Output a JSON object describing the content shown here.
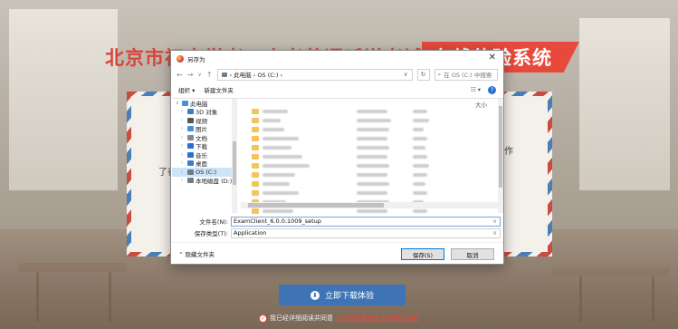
{
  "site": {
    "title_main": "北京市初中学考、高考英语听说考试",
    "title_badge": "在线体验系统",
    "env_left": "了在",
    "env_right": "制作"
  },
  "dialog": {
    "title": "另存为",
    "close": "✕",
    "nav_back": "←",
    "nav_forward": "→",
    "nav_up_arrow": "∨",
    "nav_up": "↑",
    "path": "› 此电脑 › OS (C:) ›",
    "path_dropdown": "∨",
    "refresh": "↻",
    "search_placeholder": "在 OS (C:) 中搜索",
    "organize": "组织 ▾",
    "new_folder": "新建文件夹",
    "view_icons": "☷ ▾",
    "help": "?",
    "tree": [
      {
        "label": "此电脑",
        "arrow": "∨",
        "color": "#4a90d9",
        "selected": false
      },
      {
        "label": "3D 对象",
        "arrow": "›",
        "color": "#3b7fc9",
        "selected": false
      },
      {
        "label": "视频",
        "arrow": "›",
        "color": "#555555",
        "selected": false
      },
      {
        "label": "图片",
        "arrow": "›",
        "color": "#4a90d9",
        "selected": false
      },
      {
        "label": "文档",
        "arrow": "›",
        "color": "#7a8c9c",
        "selected": false
      },
      {
        "label": "下载",
        "arrow": "›",
        "color": "#2a6fd6",
        "selected": false
      },
      {
        "label": "音乐",
        "arrow": "›",
        "color": "#2a6fd6",
        "selected": false
      },
      {
        "label": "桌面",
        "arrow": "›",
        "color": "#3b7fc9",
        "selected": false
      },
      {
        "label": "OS (C:)",
        "arrow": "›",
        "color": "#6d7d8c",
        "selected": true
      },
      {
        "label": "本地磁盘 (D:)",
        "arrow": "›",
        "color": "#6d7d8c",
        "selected": false
      }
    ],
    "size_header": "大小",
    "file_count": 12,
    "filename_label": "文件名(N):",
    "filename_value": "ExamClient_6.0.0.1009_setup",
    "savetype_label": "保存类型(T):",
    "savetype_value": "Application",
    "hide_folders": "⌃ 隐藏文件夹",
    "save_button": "保存(S)",
    "cancel_button": "取消"
  },
  "download_button": "立即下载体验",
  "download_icon": "⬇",
  "agree_text": "我已经详细阅读并同意",
  "agree_link": "在线体验系统使用的相关说明",
  "check_mark": "✓"
}
